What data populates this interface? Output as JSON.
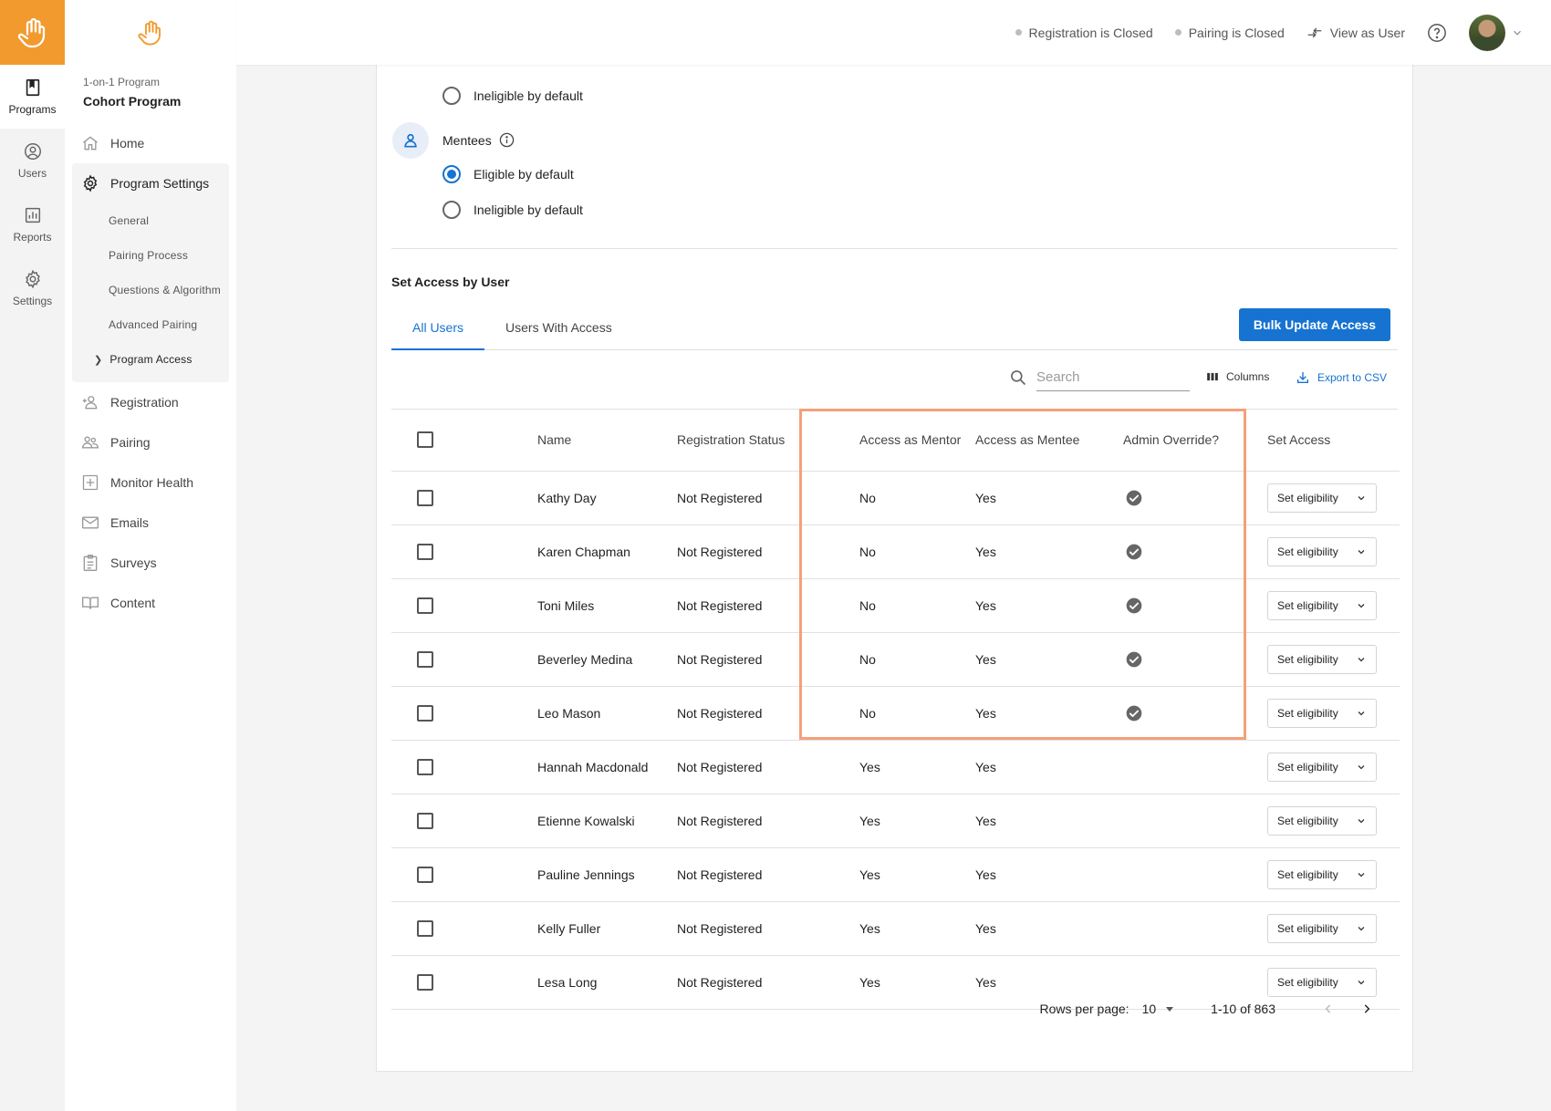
{
  "rail": {
    "items": [
      {
        "label": "Programs"
      },
      {
        "label": "Users"
      },
      {
        "label": "Reports"
      },
      {
        "label": "Settings"
      }
    ]
  },
  "nav": {
    "subtitle": "1-on-1 Program",
    "title": "Cohort Program",
    "items": [
      {
        "label": "Home"
      },
      {
        "label": "Program Settings"
      },
      {
        "label": "Registration"
      },
      {
        "label": "Pairing"
      },
      {
        "label": "Monitor Health"
      },
      {
        "label": "Emails"
      },
      {
        "label": "Surveys"
      },
      {
        "label": "Content"
      }
    ],
    "settings_sub": [
      {
        "label": "General"
      },
      {
        "label": "Pairing Process"
      },
      {
        "label": "Questions & Algorithm"
      },
      {
        "label": "Advanced Pairing"
      },
      {
        "label": "Program Access"
      }
    ]
  },
  "topbar": {
    "registration_status": "Registration is Closed",
    "pairing_status": "Pairing is Closed",
    "view_as_user": "View as User"
  },
  "defaults": {
    "mentor_ineligible_label": "Ineligible by default",
    "mentees_label": "Mentees",
    "mentee_eligible_label": "Eligible by default",
    "mentee_ineligible_label": "Ineligible by default"
  },
  "access": {
    "section_title": "Set Access by User",
    "tabs": [
      {
        "label": "All Users"
      },
      {
        "label": "Users With Access"
      }
    ],
    "bulk_button": "Bulk Update Access",
    "search_placeholder": "Search",
    "columns_label": "Columns",
    "export_label": "Export to CSV",
    "headers": {
      "name": "Name",
      "status": "Registration Status",
      "mentor": "Access as Mentor",
      "mentee": "Access as Mentee",
      "override": "Admin Override?",
      "set_access": "Set Access"
    },
    "set_eligibility_label": "Set eligibility",
    "rows": [
      {
        "name": "Kathy Day",
        "status": "Not Registered",
        "mentor": "No",
        "mentee": "Yes",
        "override": true
      },
      {
        "name": "Karen Chapman",
        "status": "Not Registered",
        "mentor": "No",
        "mentee": "Yes",
        "override": true
      },
      {
        "name": "Toni Miles",
        "status": "Not Registered",
        "mentor": "No",
        "mentee": "Yes",
        "override": true
      },
      {
        "name": "Beverley Medina",
        "status": "Not Registered",
        "mentor": "No",
        "mentee": "Yes",
        "override": true
      },
      {
        "name": "Leo Mason",
        "status": "Not Registered",
        "mentor": "No",
        "mentee": "Yes",
        "override": true
      },
      {
        "name": "Hannah Macdonald",
        "status": "Not Registered",
        "mentor": "Yes",
        "mentee": "Yes",
        "override": false
      },
      {
        "name": "Etienne Kowalski",
        "status": "Not Registered",
        "mentor": "Yes",
        "mentee": "Yes",
        "override": false
      },
      {
        "name": "Pauline Jennings",
        "status": "Not Registered",
        "mentor": "Yes",
        "mentee": "Yes",
        "override": false
      },
      {
        "name": "Kelly Fuller",
        "status": "Not Registered",
        "mentor": "Yes",
        "mentee": "Yes",
        "override": false
      },
      {
        "name": "Lesa Long",
        "status": "Not Registered",
        "mentor": "Yes",
        "mentee": "Yes",
        "override": false
      }
    ],
    "pagination": {
      "rows_per_page_label": "Rows per page:",
      "rows_per_page": "10",
      "range": "1-10 of 863"
    }
  },
  "colors": {
    "accent": "#1673d1",
    "brand": "#f29a2e",
    "highlight": "#f4a07a"
  }
}
